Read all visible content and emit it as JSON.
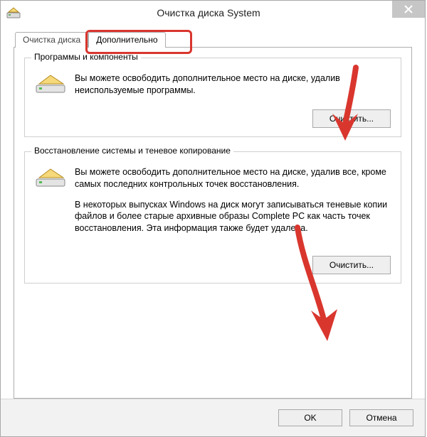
{
  "window": {
    "title": "Очистка диска System"
  },
  "tabs": {
    "items": [
      {
        "label": "Очистка диска",
        "active": false
      },
      {
        "label": "Дополнительно",
        "active": true
      }
    ]
  },
  "groups": {
    "programs": {
      "legend": "Программы и компоненты",
      "description": "Вы можете освободить дополнительное место на диске, удалив неиспользуемые программы.",
      "button": "Очистить..."
    },
    "restore": {
      "legend": "Восстановление системы и теневое копирование",
      "description1": "Вы можете освободить дополнительное место на диске, удалив все, кроме самых последних контрольных точек восстановления.",
      "description2": "В некоторых выпусках Windows на диск могут записываться теневые копии файлов и более старые архивные образы Complete PC как часть точек восстановления. Эта информация также будет удалена.",
      "button": "Очистить..."
    }
  },
  "footer": {
    "ok": "OK",
    "cancel": "Отмена"
  },
  "icons": {
    "app": "disk-cleanup-icon",
    "drive": "drive-icon",
    "close": "close-icon"
  }
}
